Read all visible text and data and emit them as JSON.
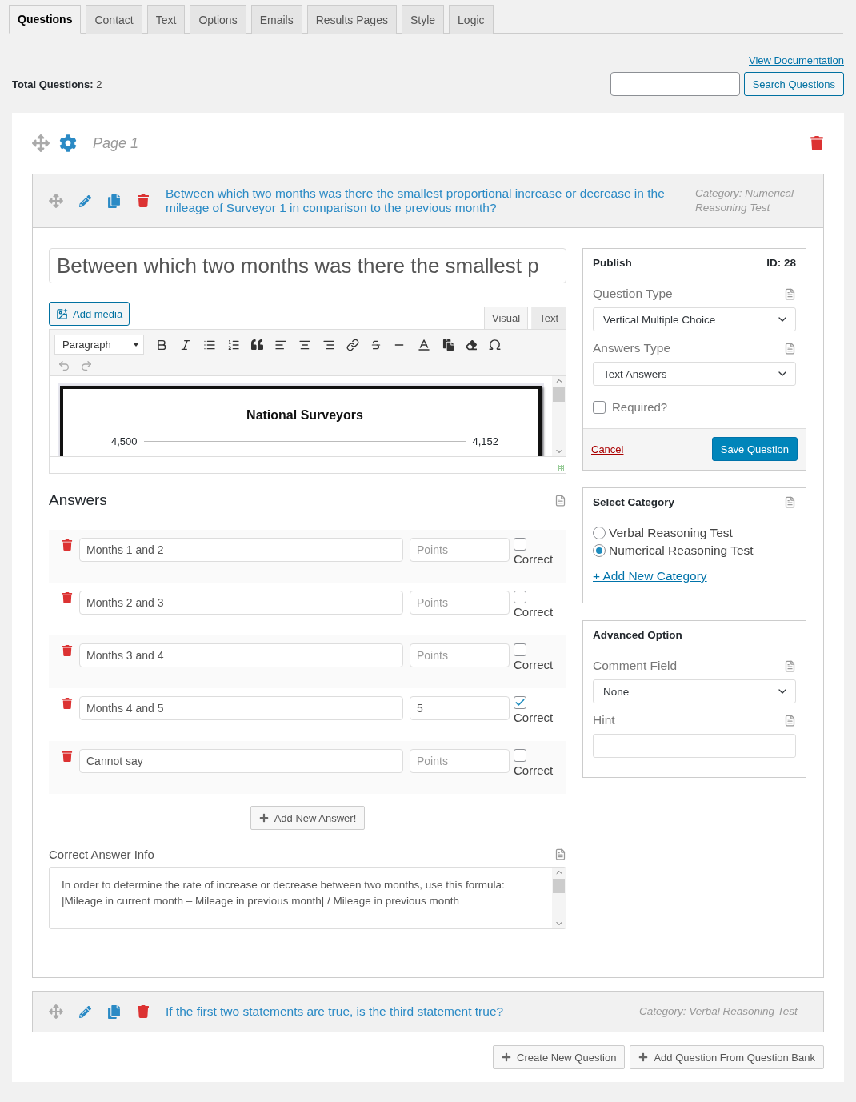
{
  "tabs": [
    {
      "label": "Questions",
      "selected": true
    },
    {
      "label": "Contact",
      "selected": false
    },
    {
      "label": "Text",
      "selected": false
    },
    {
      "label": "Options",
      "selected": false
    },
    {
      "label": "Emails",
      "selected": false
    },
    {
      "label": "Results Pages",
      "selected": false
    },
    {
      "label": "Style",
      "selected": false
    },
    {
      "label": "Logic",
      "selected": false
    }
  ],
  "view_documentation": "View Documentation",
  "total_questions": "**Total Questions:** 2",
  "search_button": "Search Questions",
  "page": {
    "title": "Page 1"
  },
  "questions": [
    {
      "title": "Between which two months was there the smallest proportional increase or decrease in the mileage of Surveyor 1 in comparison to the previous month?",
      "category": "Category: Numerical Reasoning Test",
      "expanded": true,
      "editor": {
        "title_value": "Between which two months was there the smallest p",
        "add_media": "Add media",
        "editor_tabs": [
          {
            "label": "Visual",
            "selected": true
          },
          {
            "label": "Text",
            "selected": false
          }
        ],
        "format": "Paragraph",
        "content": {
          "title": "National Surveyors",
          "labels": [
            "4,500",
            "4,152"
          ]
        },
        "answers_heading": "Answers",
        "answers": [
          {
            "value": "Months 1 and 2",
            "points_placeholder": "Points",
            "correct": false,
            "correct_label": "Correct"
          },
          {
            "value": "Months 2 and 3",
            "points_placeholder": "Points",
            "correct": false,
            "correct_label": "Correct"
          },
          {
            "value": "Months 3 and 4",
            "points_placeholder": "Points",
            "correct": false,
            "correct_label": "Correct"
          },
          {
            "value": "Months 4 and 5",
            "points": "5",
            "correct": true,
            "correct_label": "Correct"
          },
          {
            "value": "Cannot say",
            "points_placeholder": "Points",
            "correct": false,
            "correct_label": "Correct"
          }
        ],
        "add_answer": "Add New Answer!",
        "info_label": "Correct Answer Info",
        "info_text": "In order to determine the rate of increase or decrease between two months, use this formula:\n|Mileage in current month – Mileage in previous month| / Mileage in previous month",
        "publish": {
          "title": "Publish",
          "id": "ID: 28",
          "fields": [
            {
              "label": "Question Type",
              "kind": "select",
              "value": "Vertical Multiple Choice"
            },
            {
              "label": "Answers Type",
              "kind": "select",
              "value": "Text Answers"
            }
          ],
          "required": {
            "label": "Required?",
            "checked": false
          },
          "cancel": "Cancel",
          "save": "Save Question"
        },
        "category": {
          "title": "Select Category",
          "options": [
            {
              "label": "Verbal Reasoning Test",
              "selected": false
            },
            {
              "label": "Numerical Reasoning Test",
              "selected": true
            }
          ],
          "add": "+ Add New Category"
        },
        "advanced": {
          "title": "Advanced Option",
          "fields": [
            {
              "label": "Comment Field",
              "kind": "select",
              "value": "None"
            },
            {
              "label": "Hint",
              "kind": "text"
            }
          ]
        }
      }
    },
    {
      "title": "If the first two statements are true, is the third statement true?",
      "category": "Category: Verbal Reasoning Test",
      "expanded": false
    }
  ],
  "footer_buttons": [
    "Create New Question",
    "Add Question From Question Bank"
  ]
}
